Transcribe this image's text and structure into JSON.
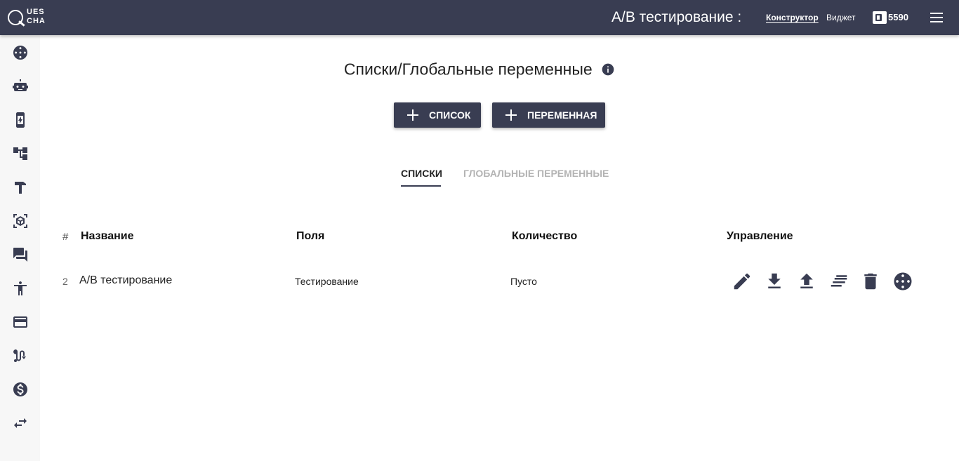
{
  "header": {
    "logo_top": "UES",
    "logo_bottom": "CHA",
    "title": "A/B тестирование :",
    "nav": [
      "Конструктор",
      "Виджет"
    ],
    "balance": "5590",
    "wallet_icon": "wallet-icon",
    "menu_icon": "hamburger-menu-icon"
  },
  "sidebar": {
    "items": [
      {
        "icon": "bowling-ball-icon"
      },
      {
        "icon": "robot-icon"
      },
      {
        "icon": "mobile-charging-icon"
      },
      {
        "icon": "hierarchy-tree-icon"
      },
      {
        "icon": "hammer-icon"
      },
      {
        "icon": "cube-scan-icon"
      },
      {
        "icon": "chat-forum-icon"
      },
      {
        "icon": "accessibility-person-icon"
      },
      {
        "icon": "credit-card-icon"
      },
      {
        "icon": "route-icon"
      },
      {
        "icon": "dollar-icon"
      },
      {
        "icon": "swap-arrows-icon"
      }
    ]
  },
  "main": {
    "title": "Списки/Глобальные переменные",
    "buttons": {
      "add_list": "СПИСОК",
      "add_variable": "ПЕРЕМЕННАЯ"
    },
    "tabs": [
      {
        "label": "СПИСКИ",
        "active": true
      },
      {
        "label": "ГЛОБАЛЬНЫЕ ПЕРЕМЕННЫЕ",
        "active": false
      }
    ],
    "table": {
      "columns": [
        "#",
        "Название",
        "Поля",
        "Количество",
        "Управление"
      ],
      "rows": [
        {
          "num": "2",
          "name": "A/B тестирование",
          "fields": "Тестирование",
          "count": "Пусто",
          "actions": [
            "edit-pencil-icon",
            "download-icon",
            "upload-icon",
            "sort-lines-icon",
            "delete-trash-icon",
            "bowling-ball-icon"
          ]
        }
      ]
    }
  },
  "colors": {
    "header_bg": "#393d52",
    "accent": "#393d52",
    "sidebar_bg": "#f7f7f7",
    "tab_inactive": "#b3b3b3"
  }
}
